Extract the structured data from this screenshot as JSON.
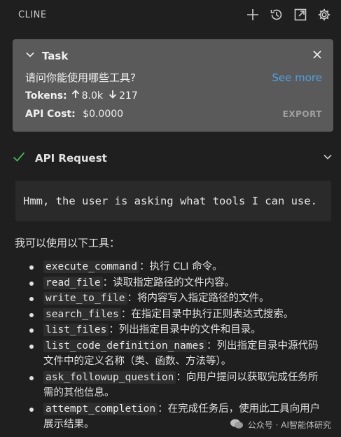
{
  "header": {
    "title": "CLINE",
    "icons": [
      "plus-icon",
      "history-icon",
      "popout-icon",
      "gear-icon"
    ]
  },
  "task": {
    "label": "Task",
    "question": "请问你能使用哪些工具?",
    "see_more": "See more",
    "tokens_label": "Tokens:",
    "tokens_up": "8.0k",
    "tokens_down": "217",
    "cost_label": "API Cost:",
    "cost_value": "$0.0000",
    "export_label": "EXPORT"
  },
  "api_request": {
    "label": "API Request",
    "status": "success"
  },
  "thought": "Hmm, the user is asking what tools I can use.",
  "response": {
    "intro": "我可以使用以下工具：",
    "tools": [
      {
        "name": "execute_command",
        "desc": "：执行 CLI 命令。"
      },
      {
        "name": "read_file",
        "desc": "：读取指定路径的文件内容。"
      },
      {
        "name": "write_to_file",
        "desc": "：将内容写入指定路径的文件。"
      },
      {
        "name": "search_files",
        "desc": "：在指定目录中执行正则表达式搜索。"
      },
      {
        "name": "list_files",
        "desc": "：列出指定目录中的文件和目录。"
      },
      {
        "name": "list_code_definition_names",
        "desc": "：列出指定目录中源代码文件中的定义名称（类、函数、方法等）。"
      },
      {
        "name": "ask_followup_question",
        "desc": "：向用户提问以获取完成任务所需的其他信息。"
      },
      {
        "name": "attempt_completion",
        "desc": "：在完成任务后，使用此工具向用户展示结果。"
      }
    ]
  },
  "watermark": "公众号 · AI智能体研究",
  "colors": {
    "background": "#1f1f1f",
    "task_card": "#5a5a5a",
    "link": "#4fa3e6",
    "success": "#3fb950"
  }
}
